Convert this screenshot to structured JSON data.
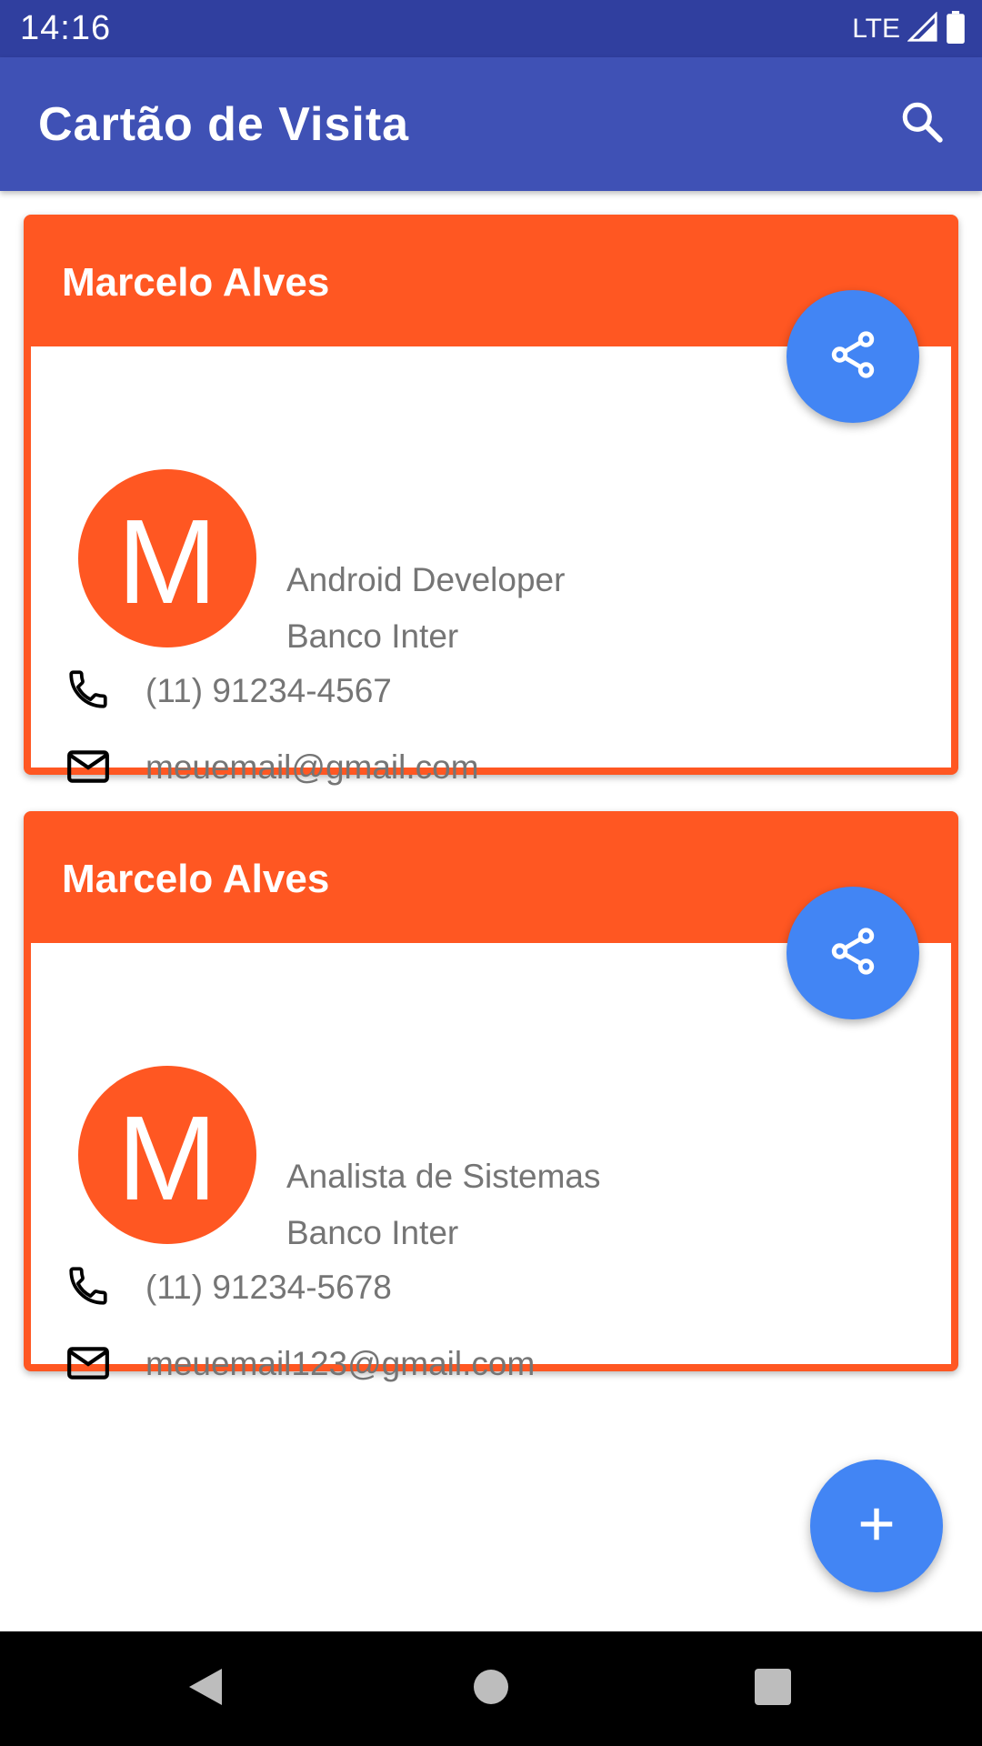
{
  "status_bar": {
    "time": "14:16",
    "network": "LTE",
    "signal_icon": "signal-icon",
    "battery_icon": "battery-icon"
  },
  "app_bar": {
    "title": "Cartão de Visita",
    "search_icon": "search-icon"
  },
  "colors": {
    "status_bar": "#303F9F",
    "app_bar": "#3F51B5",
    "card_accent": "#FF5722",
    "fab": "#4285F4",
    "secondary_text": "#757575"
  },
  "cards": [
    {
      "name": "Marcelo Alves",
      "avatar_letter": "M",
      "role": "Android Developer",
      "company": "Banco Inter",
      "phone": "(11) 91234-4567",
      "email": "meuemail@gmail.com"
    },
    {
      "name": "Marcelo Alves",
      "avatar_letter": "M",
      "role": "Analista de Sistemas",
      "company": "Banco Inter",
      "phone": "(11) 91234-5678",
      "email": "meuemail123@gmail.com"
    }
  ],
  "fab": {
    "icon": "plus-icon"
  },
  "nav_bar": {
    "back_icon": "back-icon",
    "home_icon": "home-icon",
    "recents_icon": "recents-icon"
  }
}
